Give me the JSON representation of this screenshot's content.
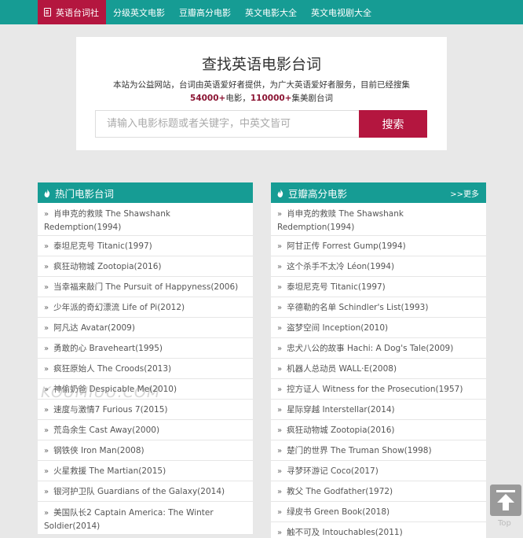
{
  "nav": {
    "brand": "英语台词社",
    "items": [
      "分级英文电影",
      "豆瓣高分电影",
      "英文电影大全",
      "英文电视剧大全"
    ]
  },
  "search": {
    "title": "查找英语电影台词",
    "desc": "本站为公益网站，台词由英语爱好者提供，为广大英语爱好者服务，目前已经搜集",
    "stats_movies": "54000+",
    "stats_movies_suffix": "电影，",
    "stats_series": "110000+",
    "stats_series_suffix": "集美剧台词",
    "placeholder": "请输入电影标题或者关键字，中英文皆可",
    "button": "搜索"
  },
  "hot": {
    "title": "热门电影台词",
    "items": [
      "肖申克的救赎 The Shawshank Redemption(1994)",
      "泰坦尼克号 Titanic(1997)",
      "疯狂动物城 Zootopia(2016)",
      "当幸福来敲门 The Pursuit of Happyness(2006)",
      "少年派的奇幻漂流 Life of Pi(2012)",
      "阿凡达 Avatar(2009)",
      "勇敢的心 Braveheart(1995)",
      "疯狂原始人 The Croods(2013)",
      "神偷奶爸 Despicable Me(2010)",
      "速度与激情7 Furious 7(2015)",
      "荒岛余生 Cast Away(2000)",
      "钢铁侠 Iron Man(2008)",
      "火星救援 The Martian(2015)",
      "银河护卫队 Guardians of the Galaxy(2014)",
      "美国队长2 Captain America: The Winter Soldier(2014)"
    ]
  },
  "douban": {
    "title": "豆瓣高分电影",
    "more": ">>更多",
    "items": [
      "肖申克的救赎 The Shawshank Redemption(1994)",
      "阿甘正传 Forrest Gump(1994)",
      "这个杀手不太冷 Léon(1994)",
      "泰坦尼克号 Titanic(1997)",
      "辛德勒的名单 Schindler's List(1993)",
      "盗梦空间 Inception(2010)",
      "忠犬八公的故事 Hachi: A Dog's Tale(2009)",
      "机器人总动员 WALL·E(2008)",
      "控方证人 Witness for the Prosecution(1957)",
      "星际穿越 Interstellar(2014)",
      "疯狂动物城 Zootopia(2016)",
      "楚门的世界 The Truman Show(1998)",
      "寻梦环游记 Coco(2017)",
      "教父 The Godfather(1972)",
      "绿皮书 Green Book(2018)",
      "触不可及 Intouchables(2011)"
    ]
  },
  "watermark": "KOUMIUU.COM",
  "back_top": "Top",
  "colors": {
    "teal": "#169c94",
    "crimson": "#b4163f"
  }
}
